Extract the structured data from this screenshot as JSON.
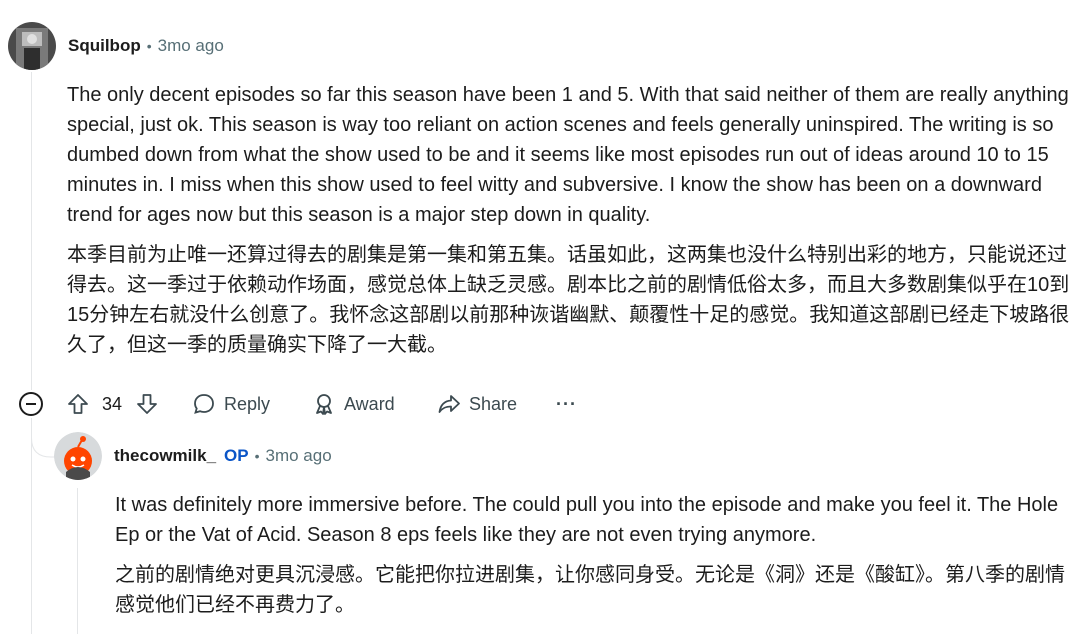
{
  "comment": {
    "author": "Squilbop",
    "time": "3mo ago",
    "paragraphs": [
      "The only decent episodes so far this season have been 1 and 5. With that said neither of them are really anything special, just ok. This season is way too reliant on action scenes and feels generally uninspired. The writing is so dumbed down from what the show used to be and it seems like most episodes run out of ideas around 10 to 15 minutes in. I miss when this show used to feel witty and subversive. I know the show has been on a downward trend for ages now but this season is a major step down in quality.",
      "本季目前为止唯一还算过得去的剧集是第一集和第五集。话虽如此，这两集也没什么特别出彩的地方，只能说还过得去。这一季过于依赖动作场面，感觉总体上缺乏灵感。剧本比之前的剧情低俗太多，而且大多数剧集似乎在10到15分钟左右就没什么创意了。我怀念这部剧以前那种诙谐幽默、颠覆性十足的感觉。我知道这部剧已经走下坡路很久了，但这一季的质量确实下降了一大截。"
    ],
    "votes": "34",
    "reply_label": "Reply",
    "award_label": "Award",
    "share_label": "Share",
    "more_label": "···"
  },
  "reply": {
    "author": "thecowmilk_",
    "op_badge": "OP",
    "time": "3mo ago",
    "paragraphs": [
      "It was definitely more immersive before. The could pull you into the episode and make you feel it. The Hole Ep or the Vat of Acid. Season 8 eps feels like they are not even trying anymore.",
      "之前的剧情绝对更具沉浸感。它能把你拉进剧集，让你感同身受。无论是《洞》还是《酸缸》。第八季的剧情感觉他们已经不再费力了。"
    ]
  }
}
